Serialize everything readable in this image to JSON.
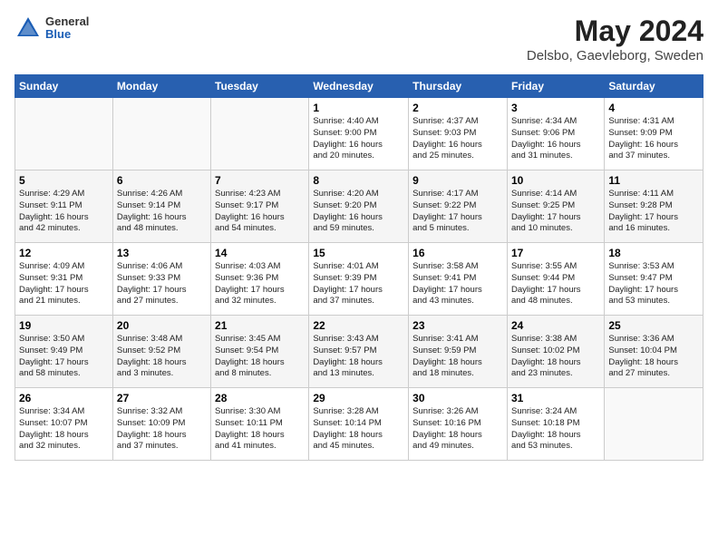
{
  "header": {
    "logo_general": "General",
    "logo_blue": "Blue",
    "month_year": "May 2024",
    "location": "Delsbo, Gaevleborg, Sweden"
  },
  "weekdays": [
    "Sunday",
    "Monday",
    "Tuesday",
    "Wednesday",
    "Thursday",
    "Friday",
    "Saturday"
  ],
  "weeks": [
    [
      {
        "day": "",
        "info": ""
      },
      {
        "day": "",
        "info": ""
      },
      {
        "day": "",
        "info": ""
      },
      {
        "day": "1",
        "info": "Sunrise: 4:40 AM\nSunset: 9:00 PM\nDaylight: 16 hours\nand 20 minutes."
      },
      {
        "day": "2",
        "info": "Sunrise: 4:37 AM\nSunset: 9:03 PM\nDaylight: 16 hours\nand 25 minutes."
      },
      {
        "day": "3",
        "info": "Sunrise: 4:34 AM\nSunset: 9:06 PM\nDaylight: 16 hours\nand 31 minutes."
      },
      {
        "day": "4",
        "info": "Sunrise: 4:31 AM\nSunset: 9:09 PM\nDaylight: 16 hours\nand 37 minutes."
      }
    ],
    [
      {
        "day": "5",
        "info": "Sunrise: 4:29 AM\nSunset: 9:11 PM\nDaylight: 16 hours\nand 42 minutes."
      },
      {
        "day": "6",
        "info": "Sunrise: 4:26 AM\nSunset: 9:14 PM\nDaylight: 16 hours\nand 48 minutes."
      },
      {
        "day": "7",
        "info": "Sunrise: 4:23 AM\nSunset: 9:17 PM\nDaylight: 16 hours\nand 54 minutes."
      },
      {
        "day": "8",
        "info": "Sunrise: 4:20 AM\nSunset: 9:20 PM\nDaylight: 16 hours\nand 59 minutes."
      },
      {
        "day": "9",
        "info": "Sunrise: 4:17 AM\nSunset: 9:22 PM\nDaylight: 17 hours\nand 5 minutes."
      },
      {
        "day": "10",
        "info": "Sunrise: 4:14 AM\nSunset: 9:25 PM\nDaylight: 17 hours\nand 10 minutes."
      },
      {
        "day": "11",
        "info": "Sunrise: 4:11 AM\nSunset: 9:28 PM\nDaylight: 17 hours\nand 16 minutes."
      }
    ],
    [
      {
        "day": "12",
        "info": "Sunrise: 4:09 AM\nSunset: 9:31 PM\nDaylight: 17 hours\nand 21 minutes."
      },
      {
        "day": "13",
        "info": "Sunrise: 4:06 AM\nSunset: 9:33 PM\nDaylight: 17 hours\nand 27 minutes."
      },
      {
        "day": "14",
        "info": "Sunrise: 4:03 AM\nSunset: 9:36 PM\nDaylight: 17 hours\nand 32 minutes."
      },
      {
        "day": "15",
        "info": "Sunrise: 4:01 AM\nSunset: 9:39 PM\nDaylight: 17 hours\nand 37 minutes."
      },
      {
        "day": "16",
        "info": "Sunrise: 3:58 AM\nSunset: 9:41 PM\nDaylight: 17 hours\nand 43 minutes."
      },
      {
        "day": "17",
        "info": "Sunrise: 3:55 AM\nSunset: 9:44 PM\nDaylight: 17 hours\nand 48 minutes."
      },
      {
        "day": "18",
        "info": "Sunrise: 3:53 AM\nSunset: 9:47 PM\nDaylight: 17 hours\nand 53 minutes."
      }
    ],
    [
      {
        "day": "19",
        "info": "Sunrise: 3:50 AM\nSunset: 9:49 PM\nDaylight: 17 hours\nand 58 minutes."
      },
      {
        "day": "20",
        "info": "Sunrise: 3:48 AM\nSunset: 9:52 PM\nDaylight: 18 hours\nand 3 minutes."
      },
      {
        "day": "21",
        "info": "Sunrise: 3:45 AM\nSunset: 9:54 PM\nDaylight: 18 hours\nand 8 minutes."
      },
      {
        "day": "22",
        "info": "Sunrise: 3:43 AM\nSunset: 9:57 PM\nDaylight: 18 hours\nand 13 minutes."
      },
      {
        "day": "23",
        "info": "Sunrise: 3:41 AM\nSunset: 9:59 PM\nDaylight: 18 hours\nand 18 minutes."
      },
      {
        "day": "24",
        "info": "Sunrise: 3:38 AM\nSunset: 10:02 PM\nDaylight: 18 hours\nand 23 minutes."
      },
      {
        "day": "25",
        "info": "Sunrise: 3:36 AM\nSunset: 10:04 PM\nDaylight: 18 hours\nand 27 minutes."
      }
    ],
    [
      {
        "day": "26",
        "info": "Sunrise: 3:34 AM\nSunset: 10:07 PM\nDaylight: 18 hours\nand 32 minutes."
      },
      {
        "day": "27",
        "info": "Sunrise: 3:32 AM\nSunset: 10:09 PM\nDaylight: 18 hours\nand 37 minutes."
      },
      {
        "day": "28",
        "info": "Sunrise: 3:30 AM\nSunset: 10:11 PM\nDaylight: 18 hours\nand 41 minutes."
      },
      {
        "day": "29",
        "info": "Sunrise: 3:28 AM\nSunset: 10:14 PM\nDaylight: 18 hours\nand 45 minutes."
      },
      {
        "day": "30",
        "info": "Sunrise: 3:26 AM\nSunset: 10:16 PM\nDaylight: 18 hours\nand 49 minutes."
      },
      {
        "day": "31",
        "info": "Sunrise: 3:24 AM\nSunset: 10:18 PM\nDaylight: 18 hours\nand 53 minutes."
      },
      {
        "day": "",
        "info": ""
      }
    ]
  ]
}
